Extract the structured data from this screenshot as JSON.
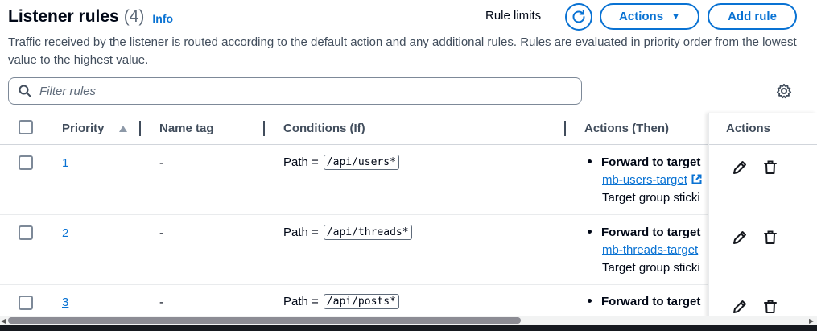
{
  "header": {
    "title": "Listener rules",
    "count": "(4)",
    "info": "Info",
    "rule_limits": "Rule limits",
    "actions_label": "Actions",
    "add_rule_label": "Add rule"
  },
  "description": "Traffic received by the listener is routed according to the default action and any additional rules. Rules are evaluated in priority order from the lowest value to the highest value.",
  "filter": {
    "placeholder": "Filter rules"
  },
  "columns": {
    "priority": "Priority",
    "name_tag": "Name tag",
    "conditions": "Conditions (If)",
    "actions_then": "Actions (Then)",
    "actions": "Actions"
  },
  "rows": [
    {
      "priority": "1",
      "name_tag": "-",
      "condition_label": "Path =",
      "condition_value": "/api/users*",
      "action_title": "Forward to target",
      "target": "mb-users-target",
      "stickiness": "Target group sticki"
    },
    {
      "priority": "2",
      "name_tag": "-",
      "condition_label": "Path =",
      "condition_value": "/api/threads*",
      "action_title": "Forward to target",
      "target": "mb-threads-target",
      "stickiness": "Target group sticki"
    },
    {
      "priority": "3",
      "name_tag": "-",
      "condition_label": "Path =",
      "condition_value": "/api/posts*",
      "action_title": "Forward to target"
    }
  ],
  "icons": {
    "refresh": "refresh-icon",
    "search": "search-icon",
    "settings": "gear-icon",
    "sort": "sort-ascending-icon",
    "edit": "pencil-icon",
    "delete": "trash-icon",
    "external": "external-link-icon"
  },
  "colors": {
    "accent": "#0972d3",
    "text": "#000716",
    "muted": "#414d5c"
  }
}
